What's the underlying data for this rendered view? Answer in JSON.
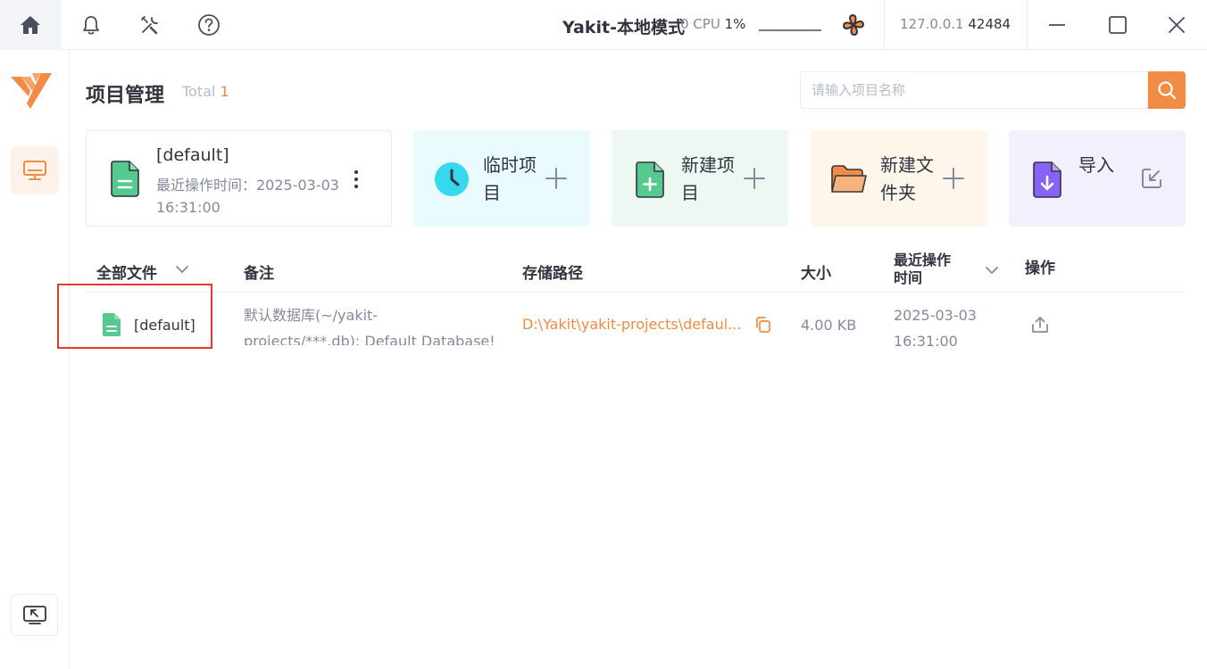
{
  "titlebar": {
    "title": "Yakit-本地模式",
    "cpu_label": "0 CPU",
    "cpu_value": "1%",
    "address_ip": "127.0.0.1",
    "address_port": "42484"
  },
  "header": {
    "title": "项目管理",
    "total_label": "Total",
    "total_count": "1",
    "search_placeholder": "请输入项目名称"
  },
  "current_project": {
    "name": "[default]",
    "time_text": "最近操作时间：2025-03-03 16:31:00"
  },
  "actions": {
    "temp_project": "临时项目",
    "new_project": "新建项目",
    "new_folder": "新建文件夹",
    "import": "导入"
  },
  "table": {
    "columns": {
      "files": "全部文件",
      "remark": "备注",
      "path": "存储路径",
      "size": "大小",
      "last_time_line1": "最近操作",
      "last_time_line2": "时间",
      "ops": "操作"
    },
    "rows": [
      {
        "name": "[default]",
        "remark_line1": "默认数据库(~/yakit-",
        "remark_line2": "projects/***.db): Default Database!",
        "path": "D:\\Yakit\\yakit-projects\\defaul...",
        "size": "4.00 KB",
        "date": "2025-03-03",
        "time": "16:31:00"
      }
    ]
  },
  "colors": {
    "accent": "#f28b44",
    "text_primary": "#31343f",
    "text_secondary": "#85899e",
    "green": "#56c991",
    "cyan": "#35d8ee",
    "purple": "#8863f7",
    "highlight_box": "#e33c2f"
  }
}
